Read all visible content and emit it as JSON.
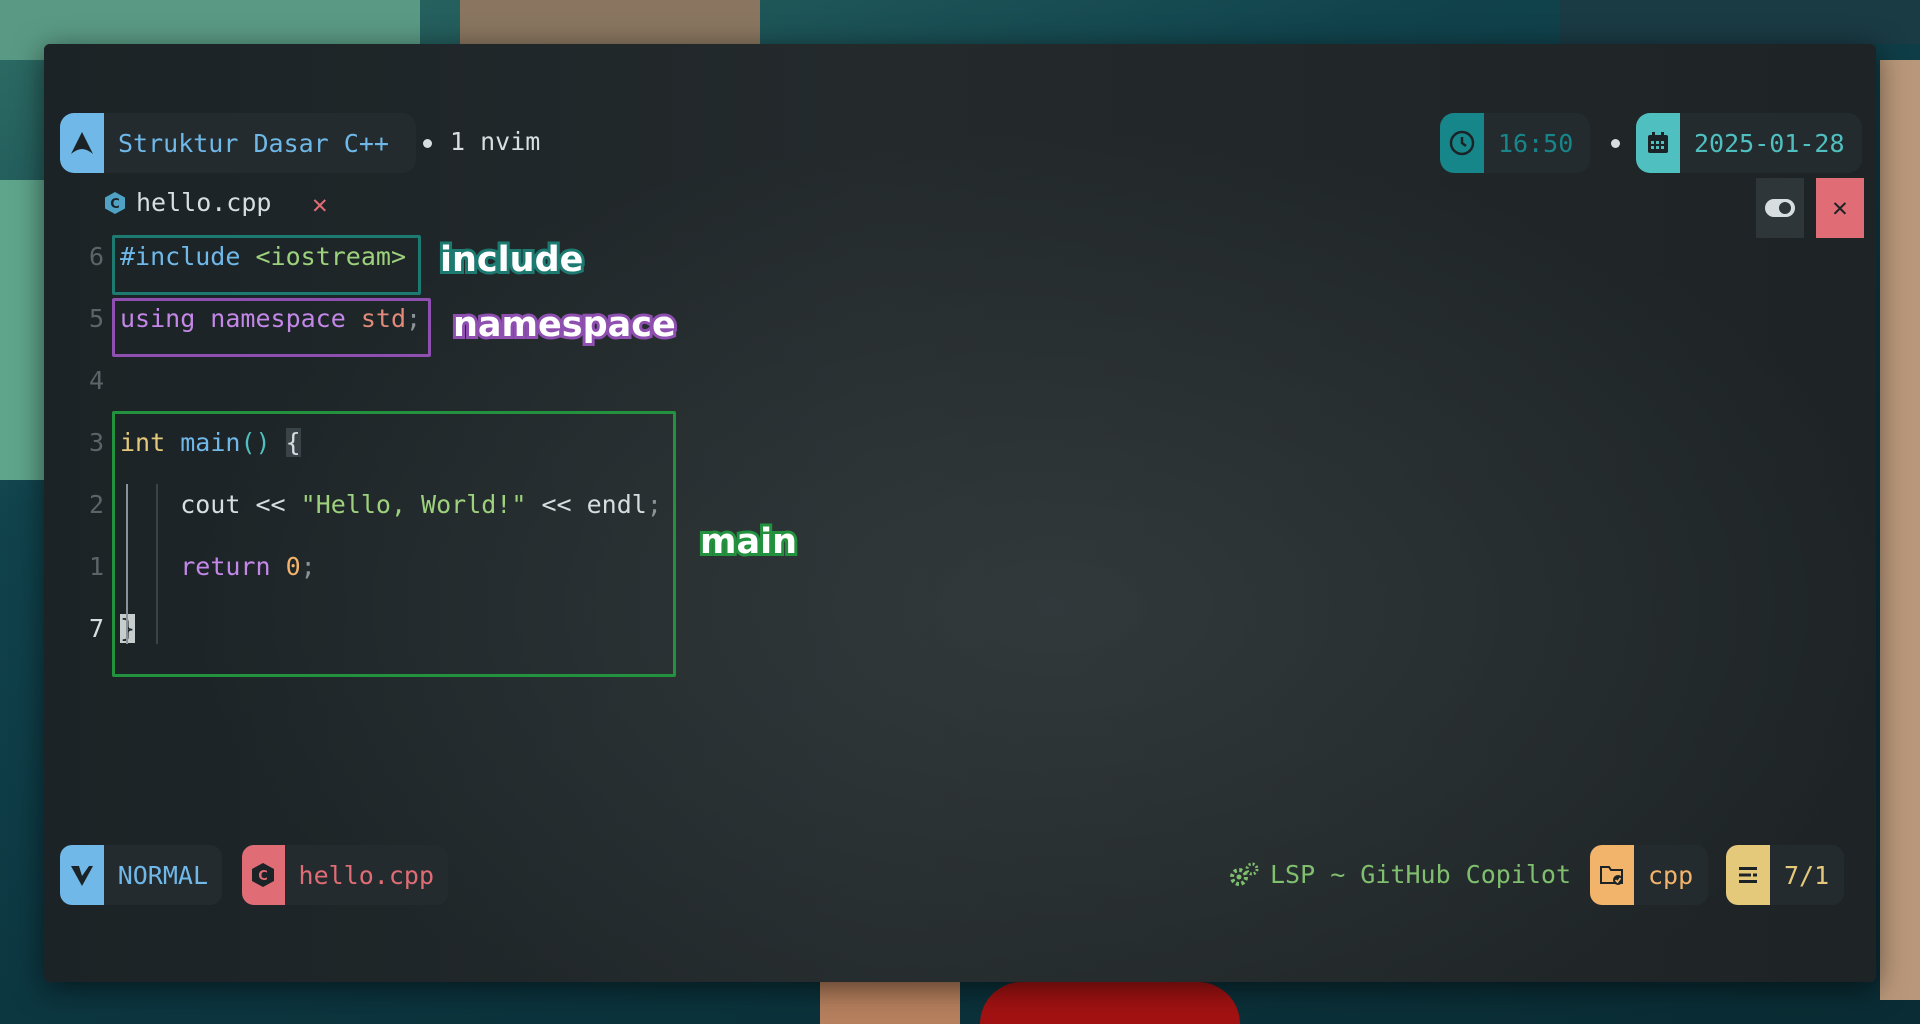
{
  "colors": {
    "accent_teal": "#17868a",
    "accent_blue": "#6fb8e8",
    "accent_red": "#e06c75",
    "accent_orange": "#f2b36a",
    "accent_yellow": "#e5c97a",
    "box_include": "#1c7a70",
    "box_namespace": "#8e4fb0",
    "box_main": "#23923f"
  },
  "topbar": {
    "session_icon": "arch-linux-icon",
    "session_title": "Struktur Dasar C++",
    "window_label": "1 nvim",
    "time_icon": "clock-icon",
    "time": "16:50",
    "date_icon": "calendar-icon",
    "date": "2025-01-28"
  },
  "bufferline": {
    "tab_icon": "cpp-file-icon",
    "tab_name": "hello.cpp",
    "close_tab_symbol": "✕",
    "toggle_icon": "toggle-icon",
    "close_window_symbol": "✕"
  },
  "code": {
    "lines": [
      {
        "num": "6",
        "tokens": [
          {
            "t": "#include",
            "c": "#6fb8e8"
          },
          {
            "t": " ",
            "c": "#d8dee0"
          },
          {
            "t": "<iostream>",
            "c": "#9dd17c"
          }
        ]
      },
      {
        "num": "5",
        "tokens": [
          {
            "t": "using namespace",
            "c": "#c387e8"
          },
          {
            "t": " ",
            "c": "#d8dee0"
          },
          {
            "t": "std",
            "c": "#e28a7a"
          },
          {
            "t": ";",
            "c": "#8a9397"
          }
        ]
      },
      {
        "num": "4",
        "tokens": []
      },
      {
        "num": "3",
        "tokens": [
          {
            "t": "int",
            "c": "#e5c97a"
          },
          {
            "t": " ",
            "c": "#d8dee0"
          },
          {
            "t": "main",
            "c": "#6fb8e8"
          },
          {
            "t": "()",
            "c": "#4fbfbf"
          },
          {
            "t": " ",
            "c": "#d8dee0"
          },
          {
            "t": "{",
            "c": "#d8dee0"
          }
        ]
      },
      {
        "num": "2",
        "tokens": [
          {
            "t": "    cout ",
            "c": "#d8dee0"
          },
          {
            "t": "<<",
            "c": "#d8dee0"
          },
          {
            "t": " ",
            "c": "#d8dee0"
          },
          {
            "t": "\"Hello, World!\"",
            "c": "#9dd17c"
          },
          {
            "t": " << endl",
            "c": "#d8dee0"
          },
          {
            "t": ";",
            "c": "#8a9397"
          }
        ]
      },
      {
        "num": "1",
        "tokens": [
          {
            "t": "    ",
            "c": "#d8dee0"
          },
          {
            "t": "return",
            "c": "#c387e8"
          },
          {
            "t": " ",
            "c": "#d8dee0"
          },
          {
            "t": "0",
            "c": "#f2b36a"
          },
          {
            "t": ";",
            "c": "#8a9397"
          }
        ]
      },
      {
        "num": "7",
        "tokens": [
          {
            "t": "}",
            "c": "#d8dee0"
          }
        ]
      }
    ],
    "labels": {
      "include": "include",
      "namespace": "namespace",
      "main": "main"
    }
  },
  "statusline": {
    "mode_icon": "vim-icon",
    "mode": "NORMAL",
    "file_icon": "cpp-file-icon",
    "file": "hello.cpp",
    "lsp_icon": "gears-icon",
    "lsp": "LSP ~ GitHub Copilot",
    "filetype_icon": "folder-check-icon",
    "filetype": "cpp",
    "position_icon": "list-icon",
    "position": "7/1"
  }
}
